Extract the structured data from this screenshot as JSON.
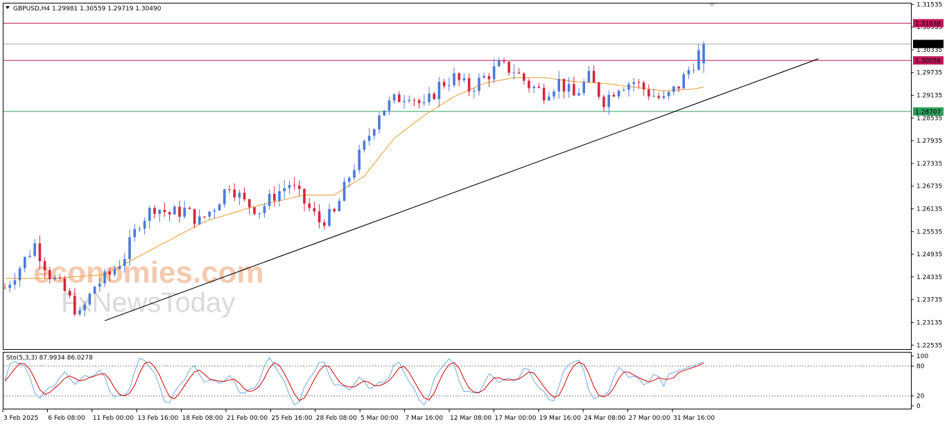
{
  "header": {
    "symbol_line": "GBPUSD,H4  1.29981 1.30559 1.29719 1.30490",
    "stoch_line": "Sto(5,3,3) 87.9934 86.0278"
  },
  "watermark": {
    "line1": "economies.com",
    "line2": "FxNewsToday",
    "color1": "#f3c4a6",
    "color2": "#d6d6d6"
  },
  "price_axis": {
    "ticks": [
      "1.31535",
      "1.30935",
      "1.30335",
      "1.29735",
      "1.29135",
      "1.28535",
      "1.27935",
      "1.27335",
      "1.26735",
      "1.26135",
      "1.25535",
      "1.24935",
      "1.24335",
      "1.23735",
      "1.23135",
      "1.22535"
    ],
    "ylim": [
      1.2243,
      1.3156
    ]
  },
  "stoch_axis": {
    "ticks": [
      "100",
      "80",
      "20",
      "0"
    ]
  },
  "time_axis": {
    "labels": [
      "3 Feb 2025",
      "6 Feb 08:00",
      "11 Feb 00:00",
      "13 Feb 16:00",
      "18 Feb 08:00",
      "21 Feb 00:00",
      "25 Feb 16:00",
      "28 Feb 08:00",
      "5 Mar 00:00",
      "7 Mar 16:00",
      "12 Mar 08:00",
      "17 Mar 00:00",
      "19 Mar 16:00",
      "24 Mar 08:00",
      "27 Mar 00:00",
      "31 Mar 16:00"
    ]
  },
  "levels": [
    {
      "name": "resistance-2",
      "label": "1.31038",
      "value": 1.31038,
      "color": "#c2185b"
    },
    {
      "name": "current-price",
      "label": "1.30490",
      "value": 1.3049,
      "color": "#aaaaaa"
    },
    {
      "name": "resistance-1",
      "label": "1.30056",
      "value": 1.30056,
      "color": "#c2185b"
    },
    {
      "name": "support",
      "label": "1.28707",
      "value": 1.28707,
      "color": "#2e9e5b"
    }
  ],
  "colors": {
    "bull": "#4a7bd8",
    "bear": "#d7263d",
    "ma": "#e8a33c",
    "trendline": "#000000",
    "stoch_main": "#6fa8dc",
    "stoch_signal": "#cc0000"
  },
  "chart_data": {
    "type": "candlestick",
    "symbol": "GBPUSD",
    "timeframe": "H4",
    "last_bar": {
      "open": 1.29981,
      "high": 1.30559,
      "low": 1.29719,
      "close": 1.3049
    },
    "close_path": [
      [
        0,
        1.2405
      ],
      [
        3,
        1.246
      ],
      [
        6,
        1.252
      ],
      [
        9,
        1.244
      ],
      [
        12,
        1.2395
      ],
      [
        15,
        1.233
      ],
      [
        18,
        1.241
      ],
      [
        21,
        1.244
      ],
      [
        24,
        1.249
      ],
      [
        27,
        1.258
      ],
      [
        30,
        1.262
      ],
      [
        33,
        1.26
      ],
      [
        36,
        1.261
      ],
      [
        39,
        1.258
      ],
      [
        42,
        1.262
      ],
      [
        45,
        1.268
      ],
      [
        48,
        1.263
      ],
      [
        51,
        1.261
      ],
      [
        54,
        1.265
      ],
      [
        57,
        1.268
      ],
      [
        60,
        1.263
      ],
      [
        63,
        1.258
      ],
      [
        66,
        1.26
      ],
      [
        69,
        1.27
      ],
      [
        72,
        1.278
      ],
      [
        75,
        1.287
      ],
      [
        78,
        1.29
      ],
      [
        81,
        1.292
      ],
      [
        84,
        1.288
      ],
      [
        87,
        1.294
      ],
      [
        90,
        1.296
      ],
      [
        93,
        1.293
      ],
      [
        96,
        1.296
      ],
      [
        99,
        1.299
      ],
      [
        102,
        1.298
      ],
      [
        105,
        1.294
      ],
      [
        108,
        1.292
      ],
      [
        111,
        1.295
      ],
      [
        114,
        1.291
      ],
      [
        117,
        1.296
      ],
      [
        120,
        1.29
      ],
      [
        123,
        1.294
      ],
      [
        126,
        1.295
      ],
      [
        129,
        1.292
      ],
      [
        132,
        1.29
      ],
      [
        135,
        1.294
      ],
      [
        138,
        1.3
      ],
      [
        140,
        1.3049
      ]
    ],
    "moving_average": [
      [
        0,
        1.243
      ],
      [
        10,
        1.243
      ],
      [
        20,
        1.244
      ],
      [
        30,
        1.251
      ],
      [
        40,
        1.258
      ],
      [
        50,
        1.262
      ],
      [
        60,
        1.265
      ],
      [
        66,
        1.265
      ],
      [
        72,
        1.27
      ],
      [
        78,
        1.28
      ],
      [
        84,
        1.286
      ],
      [
        90,
        1.291
      ],
      [
        96,
        1.2945
      ],
      [
        102,
        1.296
      ],
      [
        108,
        1.296
      ],
      [
        114,
        1.295
      ],
      [
        120,
        1.2945
      ],
      [
        126,
        1.2935
      ],
      [
        132,
        1.2925
      ],
      [
        138,
        1.293
      ],
      [
        140,
        1.2935
      ]
    ],
    "trendline": {
      "from": [
        20,
        1.2318
      ],
      "to": [
        163,
        1.301
      ]
    },
    "stochastic": {
      "k": 87.9934,
      "d": 86.0278,
      "levels": [
        80,
        20
      ]
    },
    "ylim": [
      1.2243,
      1.3156
    ]
  }
}
